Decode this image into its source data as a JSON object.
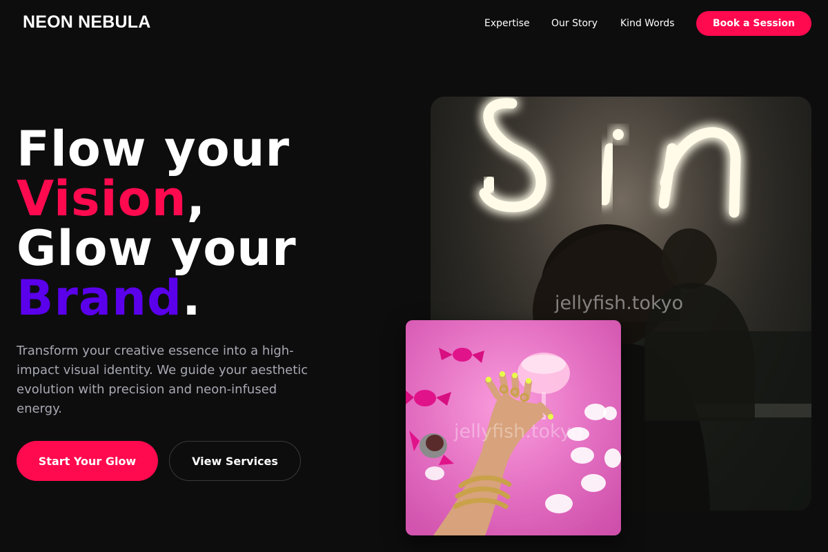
{
  "brand": {
    "name": "NEON NEBULA"
  },
  "nav": {
    "links": [
      "Expertise",
      "Our Story",
      "Kind Words"
    ],
    "cta": "Book a Session"
  },
  "hero": {
    "line1": "Flow your",
    "line2_accent": "Vision",
    "line2_punct": ",",
    "line3": "Glow your",
    "line4_accent": "Brand",
    "line4_punct": ".",
    "description": "Transform your creative essence into a high-impact visual identity. We guide your aesthetic evolution with precision and neon-infused energy.",
    "primary_button": "Start Your Glow",
    "secondary_button": "View Services"
  },
  "images": {
    "large_watermark": "jellyfish.tokyo",
    "large_sign_text": "Sin",
    "small_watermark": "jellyfish.tokyo"
  },
  "colors": {
    "background": "#0d0d0e",
    "accent_red": "#ff0a4f",
    "accent_purple": "#5a00ea",
    "muted_text": "#a9a9b3"
  }
}
